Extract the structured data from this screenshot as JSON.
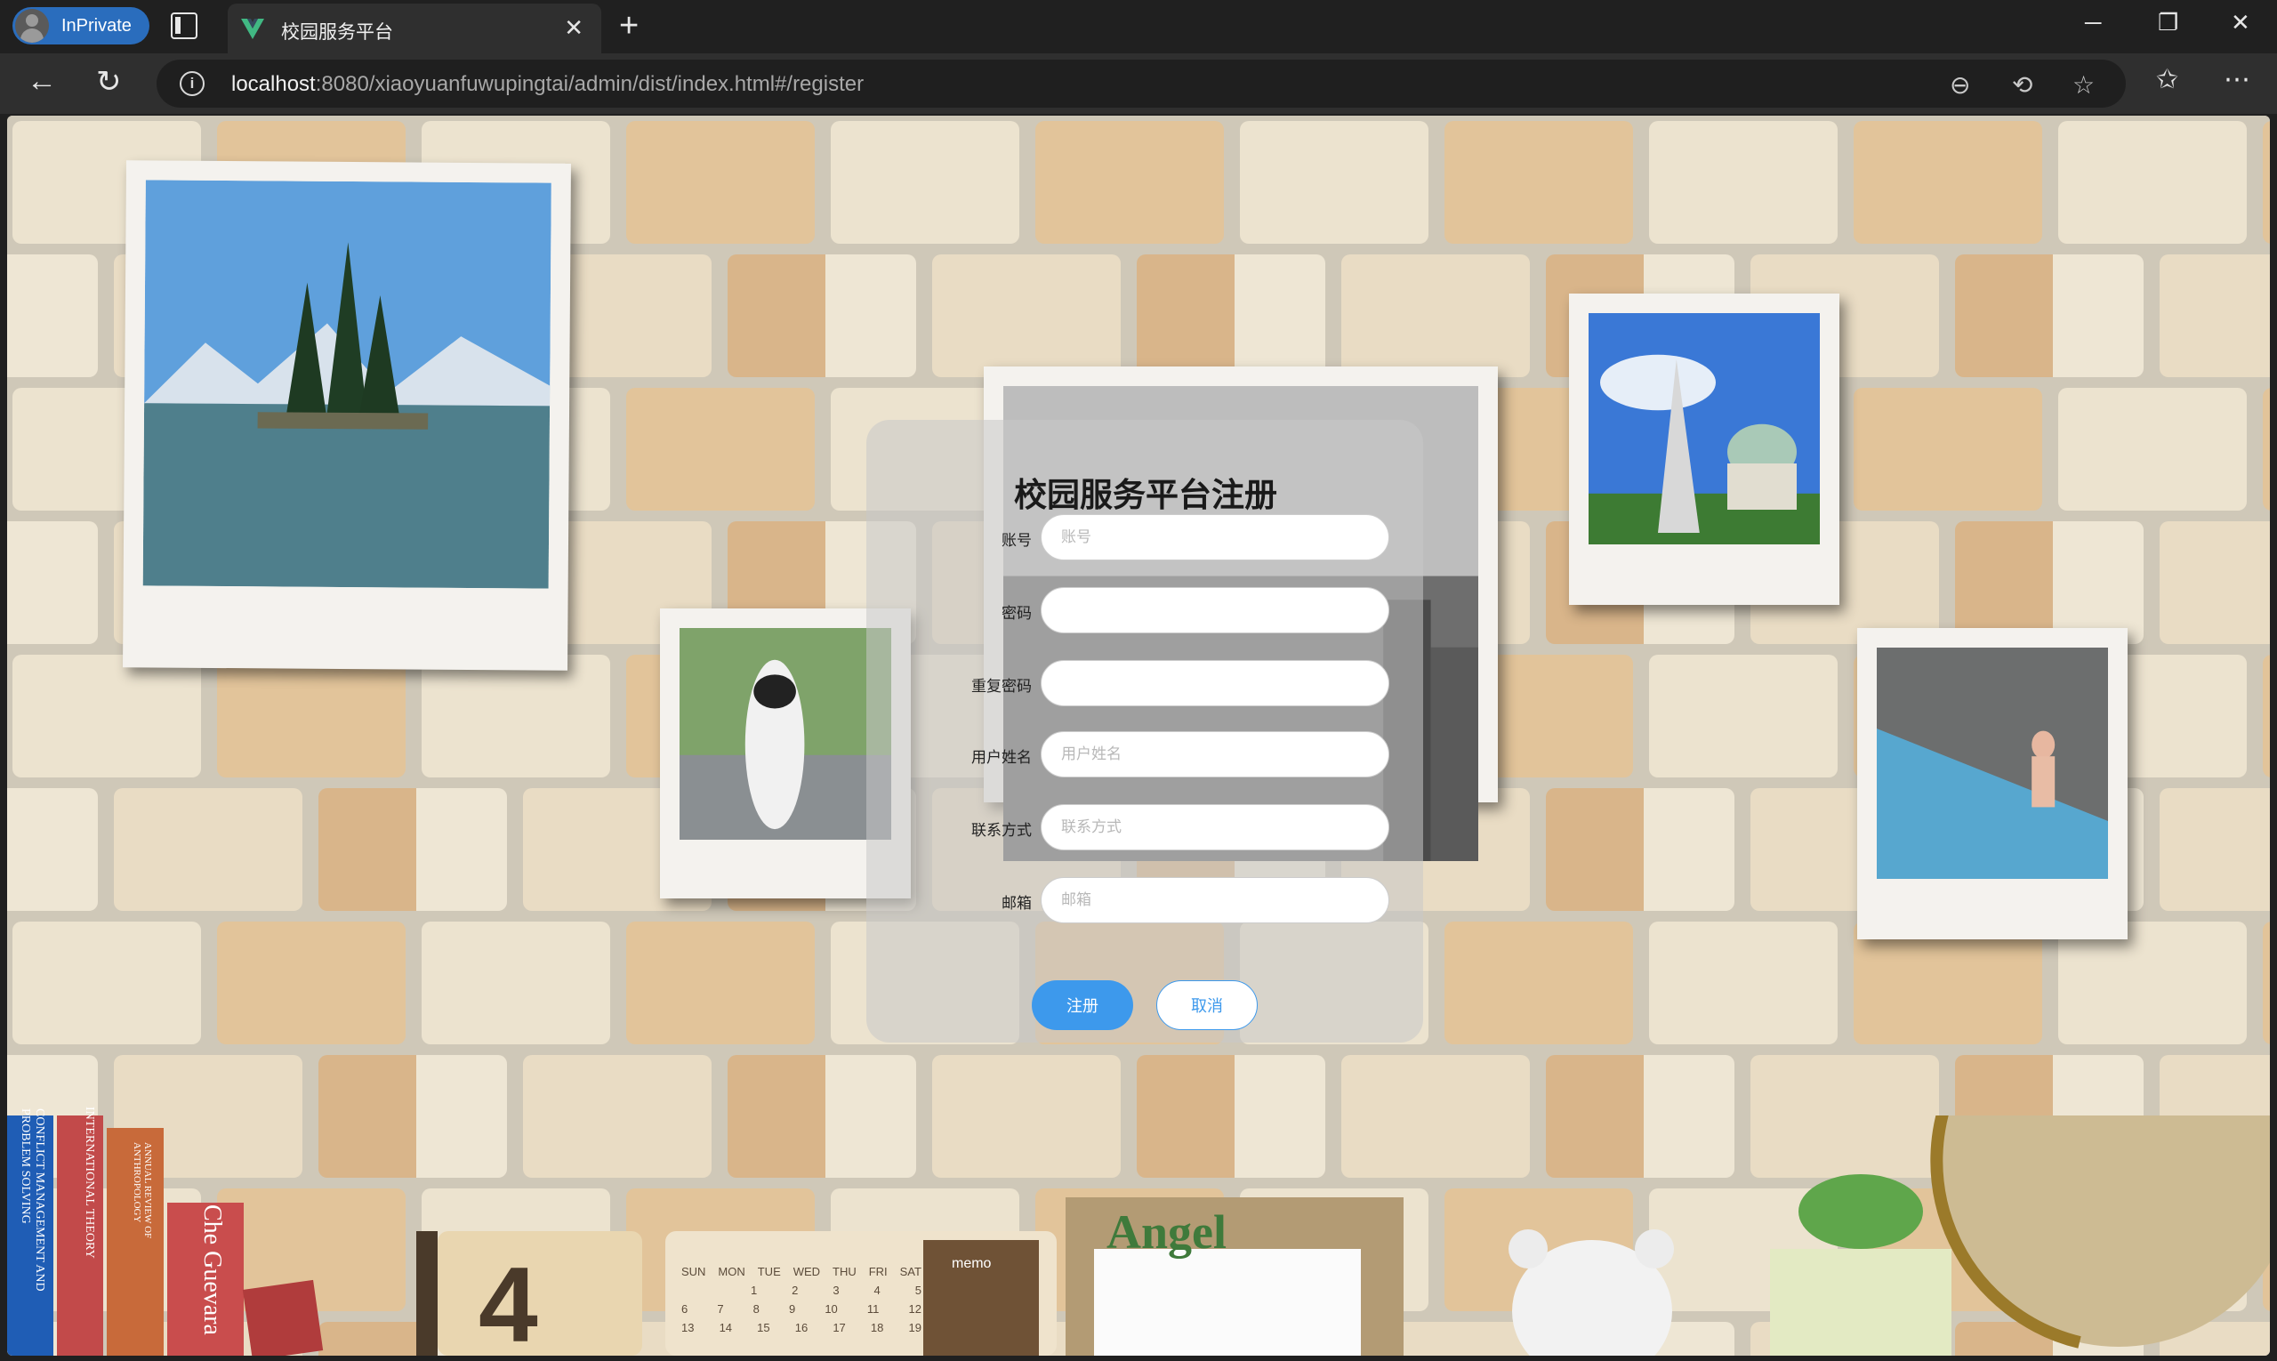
{
  "browser": {
    "inprivate_label": "InPrivate",
    "tab_title": "校园服务平台",
    "url_host": "localhost",
    "url_rest": ":8080/xiaoyuanfuwupingtai/admin/dist/index.html#/register"
  },
  "form": {
    "title": "校园服务平台注册",
    "fields": [
      {
        "label": "账号",
        "placeholder": "账号",
        "type": "text"
      },
      {
        "label": "密码",
        "placeholder": "",
        "type": "password"
      },
      {
        "label": "重复密码",
        "placeholder": "",
        "type": "password"
      },
      {
        "label": "用户姓名",
        "placeholder": "用户姓名",
        "type": "text"
      },
      {
        "label": "联系方式",
        "placeholder": "联系方式",
        "type": "text"
      },
      {
        "label": "邮箱",
        "placeholder": "邮箱",
        "type": "text"
      }
    ],
    "submit_label": "注册",
    "cancel_label": "取消",
    "accent_color": "#3d99ec"
  },
  "decor": {
    "books": [
      "CONFLICT MANAGEMENT AND PROBLEM SOLVING",
      "INTERNATIONAL THEORY",
      "ANNUAL REVIEW OF ANTHROPOLOGY",
      "Che Guevara"
    ],
    "calendar_number": "4",
    "calendar_days": [
      "SUN",
      "MON",
      "TUE",
      "WED",
      "THU",
      "FRI",
      "SAT"
    ],
    "calendar_rows": [
      [
        "",
        "",
        "1",
        "2",
        "3",
        "4",
        "5"
      ],
      [
        "6",
        "7",
        "8",
        "9",
        "10",
        "11",
        "12"
      ],
      [
        "13",
        "14",
        "15",
        "16",
        "17",
        "18",
        "19"
      ]
    ],
    "memo_label": "memo",
    "angel_label": "Angel"
  }
}
